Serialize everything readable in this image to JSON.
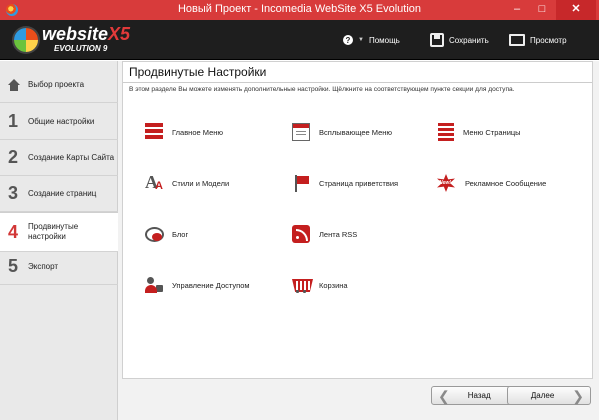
{
  "window": {
    "title": "Новый Проект - Incomedia WebSite X5 Evolution",
    "controls": {
      "minimize": "–",
      "maximize": "□",
      "close": "✕"
    }
  },
  "header": {
    "logo_text": "website",
    "logo_x5": "X5",
    "logo_edition": "EVOLUTION 9",
    "help_label": "Помощь",
    "save_label": "Сохранить",
    "preview_label": "Просмотр"
  },
  "sidebar": {
    "items": [
      {
        "num": "",
        "label": "Выбор проекта",
        "icon": "home-icon"
      },
      {
        "num": "1",
        "label": "Общие настройки"
      },
      {
        "num": "2",
        "label": "Создание Карты Сайта"
      },
      {
        "num": "3",
        "label": "Создание страниц"
      },
      {
        "num": "4",
        "label": "Продвинутые настройки",
        "active": true
      },
      {
        "num": "5",
        "label": "Экспорт"
      }
    ]
  },
  "main": {
    "title": "Продвинутые Настройки",
    "description": "В этом разделе Вы можете изменять дополнительные настройки. Щёлкните на соответствующем пункте секции для доступа.",
    "tiles": [
      {
        "label": "Главное Меню",
        "icon": "main-menu-icon"
      },
      {
        "label": "Всплывающее Меню",
        "icon": "popup-menu-icon"
      },
      {
        "label": "Меню Страницы",
        "icon": "page-menu-icon"
      },
      {
        "label": "Стили и Модели",
        "icon": "styles-icon"
      },
      {
        "label": "Страница приветствия",
        "icon": "flag-icon"
      },
      {
        "label": "Рекламное Сообщение",
        "icon": "new-badge-icon"
      },
      {
        "label": "Блог",
        "icon": "blog-icon"
      },
      {
        "label": "Лента RSS",
        "icon": "rss-icon"
      },
      {
        "label": "Управление Доступом",
        "icon": "access-icon"
      },
      {
        "label": "Корзина",
        "icon": "cart-icon"
      }
    ]
  },
  "footer": {
    "back_label": "Назад",
    "next_label": "Далее"
  },
  "colors": {
    "titlebar": "#d83b3b",
    "header_bg": "#1e1e1e",
    "accent": "#c41f1f"
  }
}
